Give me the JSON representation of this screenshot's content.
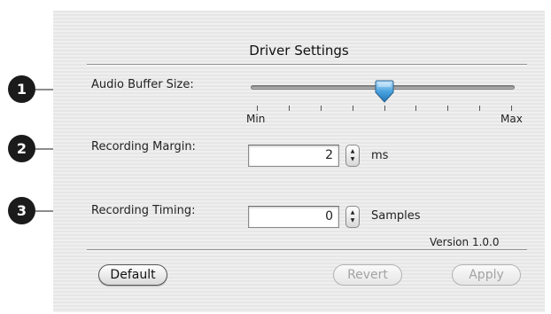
{
  "dialog": {
    "title": "Driver Settings",
    "version": "Version 1.0.0"
  },
  "callouts": [
    "1",
    "2",
    "3"
  ],
  "audio_buffer": {
    "label": "Audio Buffer Size:",
    "min_label": "Min",
    "max_label": "Max",
    "tick_count": 9,
    "level_fraction": 0.5
  },
  "recording_margin": {
    "label": "Recording Margin:",
    "value": "2",
    "unit": "ms"
  },
  "recording_timing": {
    "label": "Recording Timing:",
    "value": "0",
    "unit": "Samples"
  },
  "buttons": {
    "default": "Default",
    "revert": "Revert",
    "apply": "Apply"
  },
  "colors": {
    "thumb": "#4aa3df",
    "callout": "#1b1b1b"
  }
}
